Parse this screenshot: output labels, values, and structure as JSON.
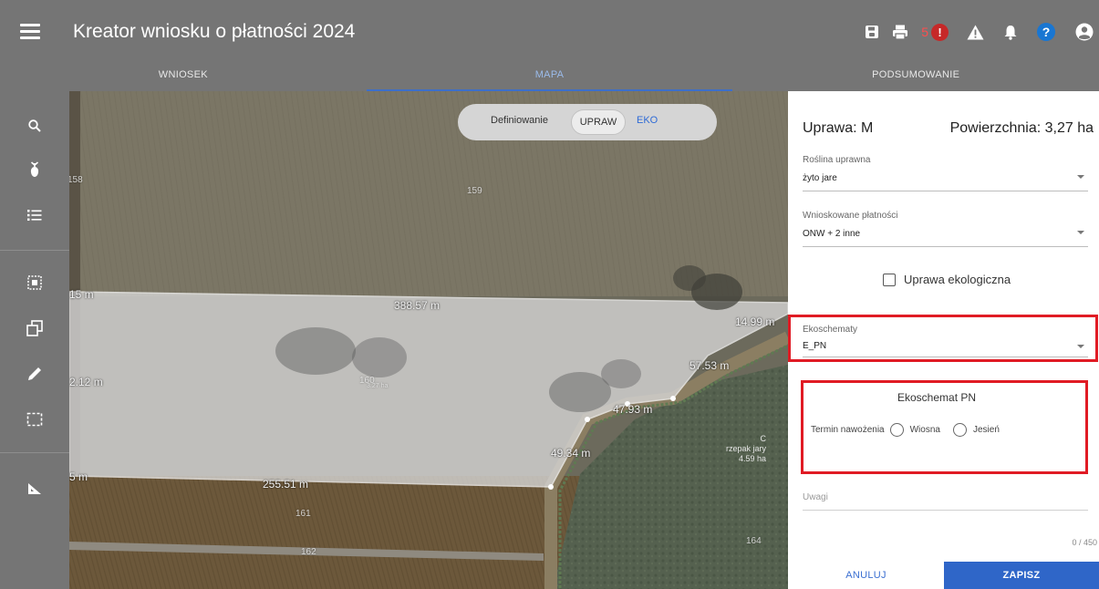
{
  "app": {
    "title": "Kreator wniosku o płatności 2024"
  },
  "header": {
    "notification_count": "5",
    "warning_symbol": "!",
    "help_symbol": "?"
  },
  "tabs": [
    {
      "label": "WNIOSEK",
      "active": false
    },
    {
      "label": "MAPA",
      "active": true
    },
    {
      "label": "PODSUMOWANIE",
      "active": false
    }
  ],
  "toolbar": {
    "tools": [
      "search-icon",
      "crop-plant-icon",
      "list-icon",
      "select-area-icon",
      "copy-icon",
      "pencil-icon",
      "rectangle-select-icon",
      "measure-icon"
    ]
  },
  "map": {
    "mode": {
      "label": "Definiowanie",
      "upraw": "UPRAW",
      "eko": "EKO"
    },
    "parcel_numbers": [
      "158",
      "159",
      "160",
      "161",
      "162",
      "164"
    ],
    "parcel_area_label": "3.27 ha",
    "measurements": [
      "388.57 m",
      "14.99 m",
      "57.53 m",
      "47.93 m",
      "49.34 m",
      "255.51 m",
      "2.12 m",
      "5 m",
      "15 m"
    ],
    "neighbor_crop": {
      "letter": "C",
      "crop": "rzepak jary",
      "area": "4.59 ha"
    }
  },
  "panel": {
    "title": "Uprawa: M",
    "area": "Powierzchnia: 3,27 ha",
    "plant": {
      "label": "Roślina uprawna",
      "value": "żyto jare"
    },
    "payments": {
      "label": "Wnioskowane płatności",
      "value": "ONW + 2 inne"
    },
    "organic_label": "Uprawa ekologiczna",
    "organic_checked": false,
    "ecoschemes": {
      "label": "Ekoschematy",
      "value": "E_PN"
    },
    "pn": {
      "title": "Ekoschemat PN",
      "term_label": "Termin nawożenia",
      "option_spring": "Wiosna",
      "option_autumn": "Jesień"
    },
    "notes": {
      "label": "Uwagi",
      "counter": "0 / 450"
    },
    "cancel_label": "ANULUJ",
    "save_label": "ZAPISZ"
  },
  "colors": {
    "accent": "#2f66c8",
    "highlight": "#e01b24",
    "chrome": "#757575"
  }
}
